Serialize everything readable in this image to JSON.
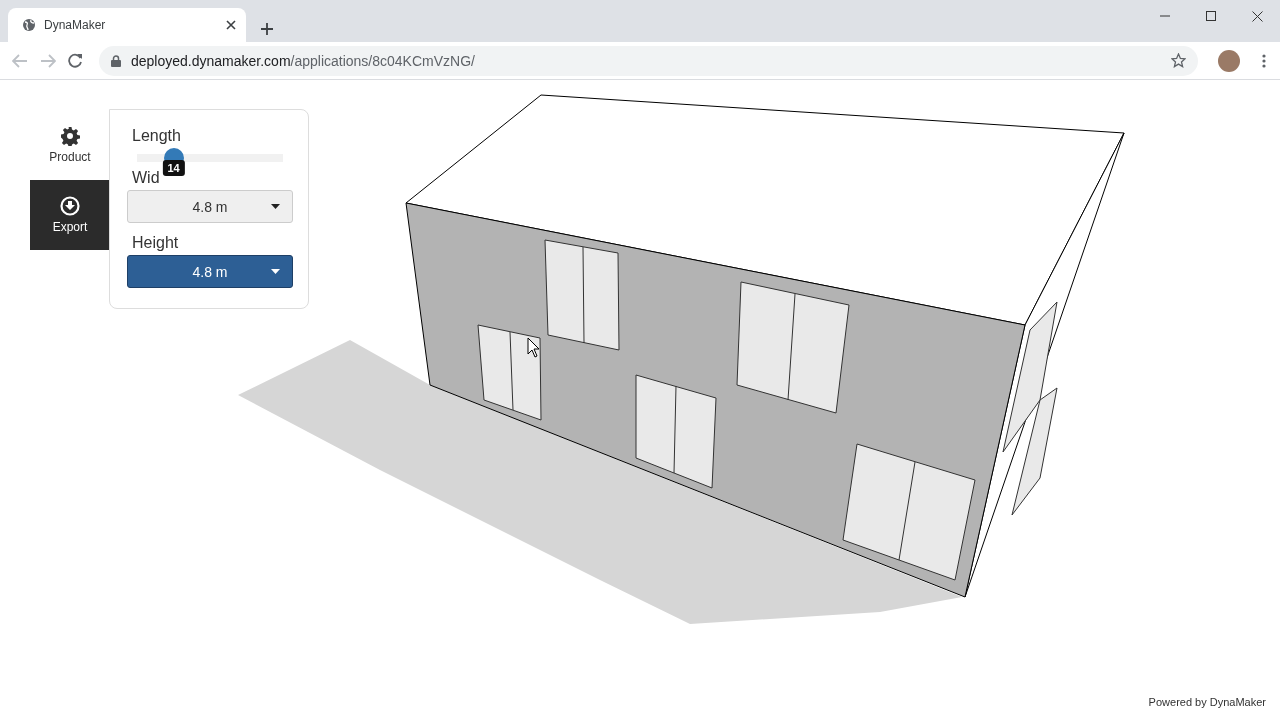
{
  "browser": {
    "tab_title": "DynaMaker",
    "url_host": "deployed.dynamaker.com",
    "url_path": "/applications/8c04KCmVzNG/"
  },
  "side_tabs": [
    {
      "label": "Product",
      "selected": true
    },
    {
      "label": "Export",
      "selected": false
    }
  ],
  "slider": {
    "label": "Length",
    "level": 0.25,
    "tooltip": "14"
  },
  "dropdowns": [
    {
      "label": "Wid",
      "value": "4.8 m",
      "active": false
    },
    {
      "label": "Height",
      "value": "4.8 m",
      "active": true
    }
  ],
  "footer": "Powered by DynaMaker"
}
